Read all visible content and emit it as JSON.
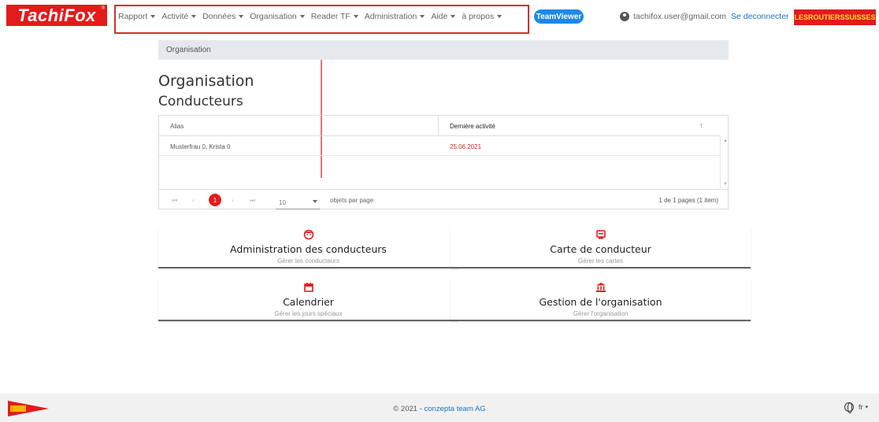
{
  "brand": {
    "logo_text": "TachiFox",
    "logo_mark": "®"
  },
  "nav": {
    "items": [
      {
        "label": "Rapport"
      },
      {
        "label": "Activité"
      },
      {
        "label": "Données"
      },
      {
        "label": "Organisation"
      },
      {
        "label": "Reader TF"
      },
      {
        "label": "Administration"
      },
      {
        "label": "Aide"
      },
      {
        "label": "à propos"
      }
    ],
    "teamviewer_label": "TeamViewer",
    "user_email": "tachifox.user@gmail.com",
    "logout_label": "Se deconnecter",
    "org_badge": "LESROUTIERSSUISSES"
  },
  "breadcrumb": {
    "label": "Organisation"
  },
  "page": {
    "title": "Organisation",
    "subtitle": "Conducteurs"
  },
  "table": {
    "columns": [
      "Alias",
      "Dernière activité"
    ],
    "rows": [
      {
        "alias": "Musterfrau 0, Krista 0",
        "last_activity": "25.06.2021"
      }
    ],
    "pager": {
      "first": "⏮",
      "prev": "‹",
      "current_page": "1",
      "next": "›",
      "last": "⏭",
      "page_size": "10",
      "page_size_label": "objets par page",
      "info": "1 de 1 pages (1 item)"
    }
  },
  "cards": [
    {
      "title": "Administration des conducteurs",
      "subtitle": "Gérer les conducteurs",
      "icon": "driver-face-icon"
    },
    {
      "title": "Carte de conducteur",
      "subtitle": "Gérer les cartes",
      "icon": "card-icon"
    },
    {
      "title": "Calendrier",
      "subtitle": "Gérer les jours spéciaux",
      "icon": "calendar-icon"
    },
    {
      "title": "Gestion de l'organisation",
      "subtitle": "Gérer l'organisation",
      "icon": "institution-icon"
    }
  ],
  "footer": {
    "copyright_prefix": "© 2021 - ",
    "copyright_link": "conzepta team AG",
    "language": "fr"
  },
  "colors": {
    "brand_red": "#e31b1b",
    "link_blue": "#1e73be",
    "annotation_red": "#d32f2f"
  }
}
